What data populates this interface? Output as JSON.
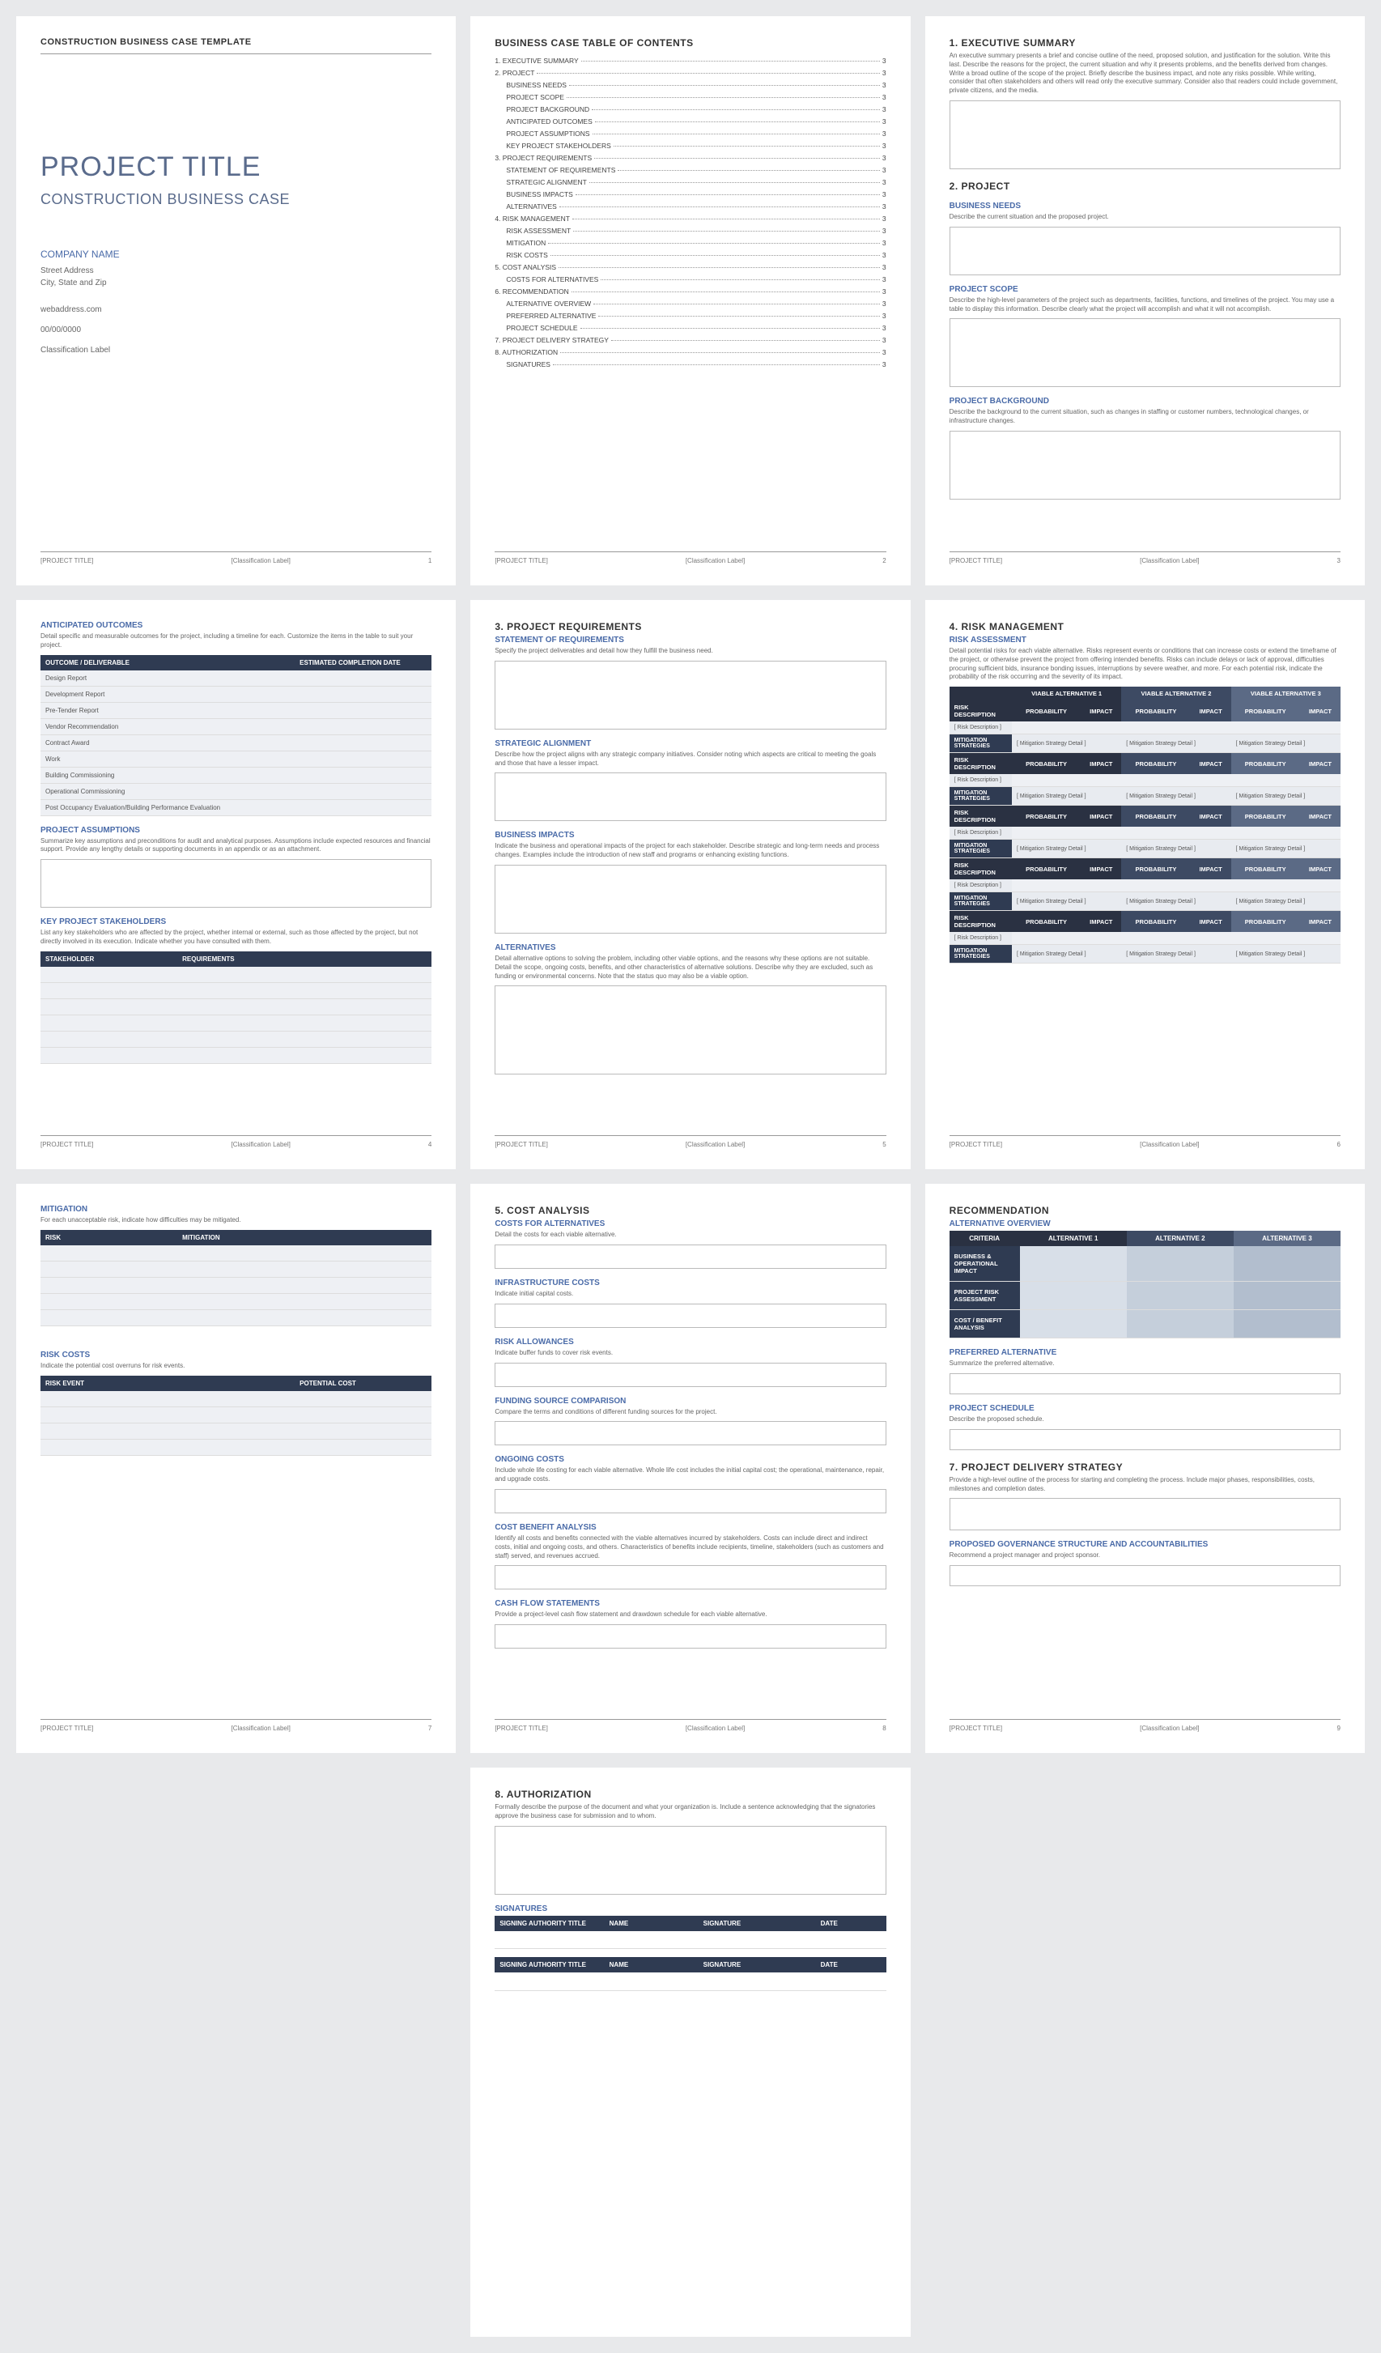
{
  "doc": {
    "header": "CONSTRUCTION BUSINESS CASE TEMPLATE",
    "projTitle": "PROJECT TITLE",
    "projSub": "CONSTRUCTION BUSINESS CASE",
    "company": "COMPANY NAME",
    "street": "Street Address",
    "city": "City, State and Zip",
    "web": "webaddress.com",
    "date": "00/00/0000",
    "classification": "Classification Label"
  },
  "footer": {
    "left": "[PROJECT TITLE]",
    "center": "[Classification Label]"
  },
  "pageNums": {
    "p1": "1",
    "p2": "2",
    "p3": "3",
    "p4": "4",
    "p5": "5",
    "p6": "6",
    "p7": "7",
    "p8": "8",
    "p9": "9"
  },
  "toc": {
    "title": "BUSINESS CASE TABLE OF CONTENTS",
    "items": [
      {
        "l": "1.  EXECUTIVE SUMMARY",
        "p": "3",
        "s": 0
      },
      {
        "l": "2.  PROJECT",
        "p": "3",
        "s": 0
      },
      {
        "l": "BUSINESS NEEDS",
        "p": "3",
        "s": 1
      },
      {
        "l": "PROJECT SCOPE",
        "p": "3",
        "s": 1
      },
      {
        "l": "PROJECT BACKGROUND",
        "p": "3",
        "s": 1
      },
      {
        "l": "ANTICIPATED OUTCOMES",
        "p": "3",
        "s": 1
      },
      {
        "l": "PROJECT ASSUMPTIONS",
        "p": "3",
        "s": 1
      },
      {
        "l": "KEY PROJECT STAKEHOLDERS",
        "p": "3",
        "s": 1
      },
      {
        "l": "3.  PROJECT REQUIREMENTS",
        "p": "3",
        "s": 0
      },
      {
        "l": "STATEMENT OF REQUIREMENTS",
        "p": "3",
        "s": 1
      },
      {
        "l": "STRATEGIC ALIGNMENT",
        "p": "3",
        "s": 1
      },
      {
        "l": "BUSINESS IMPACTS",
        "p": "3",
        "s": 1
      },
      {
        "l": "ALTERNATIVES",
        "p": "3",
        "s": 1
      },
      {
        "l": "4.  RISK MANAGEMENT",
        "p": "3",
        "s": 0
      },
      {
        "l": "RISK ASSESSMENT",
        "p": "3",
        "s": 1
      },
      {
        "l": "MITIGATION",
        "p": "3",
        "s": 1
      },
      {
        "l": "RISK COSTS",
        "p": "3",
        "s": 1
      },
      {
        "l": "5.  COST ANALYSIS",
        "p": "3",
        "s": 0
      },
      {
        "l": "COSTS FOR ALTERNATIVES",
        "p": "3",
        "s": 1
      },
      {
        "l": "6.  RECOMMENDATION",
        "p": "3",
        "s": 0
      },
      {
        "l": "ALTERNATIVE OVERVIEW",
        "p": "3",
        "s": 1
      },
      {
        "l": "PREFERRED ALTERNATIVE",
        "p": "3",
        "s": 1
      },
      {
        "l": "PROJECT SCHEDULE",
        "p": "3",
        "s": 1
      },
      {
        "l": "7.  PROJECT DELIVERY STRATEGY",
        "p": "3",
        "s": 0
      },
      {
        "l": "8.  AUTHORIZATION",
        "p": "3",
        "s": 0
      },
      {
        "l": "SIGNATURES",
        "p": "3",
        "s": 1
      }
    ]
  },
  "p3": {
    "h1": "1. EXECUTIVE SUMMARY",
    "d1": "An executive summary presents a brief and concise outline of the need, proposed solution, and justification for the solution. Write this last. Describe the reasons for the project, the current situation and why it presents problems, and the benefits derived from changes. Write a broad outline of the scope of the project. Briefly describe the business impact, and note any risks possible. While writing, consider that often stakeholders and others will read only the executive summary. Consider also that readers could include government, private citizens, and the media.",
    "h2": "2. PROJECT",
    "bn": "BUSINESS NEEDS",
    "bnd": "Describe the current situation and the proposed project.",
    "ps": "PROJECT SCOPE",
    "psd": "Describe the high-level parameters of the project such as departments, facilities, functions, and timelines of the project. You may use a table to display this information. Describe clearly what the project will accomplish and what it will not accomplish.",
    "pb": "PROJECT BACKGROUND",
    "pbd": "Describe the background to the current situation, such as changes in staffing or customer numbers, technological changes, or infrastructure changes."
  },
  "p4": {
    "ao": "ANTICIPATED OUTCOMES",
    "aod": "Detail specific and measurable outcomes for the project, including a timeline for each. Customize the items in the table to suit your project.",
    "th1": "OUTCOME / DELIVERABLE",
    "th2": "ESTIMATED COMPLETION DATE",
    "rows": [
      "Design Report",
      "Development Report",
      "Pre-Tender Report",
      "Vendor Recommendation",
      "Contract Award",
      "Work",
      "Building Commissioning",
      "Operational Commissioning",
      "Post Occupancy Evaluation/Building Performance Evaluation"
    ],
    "pa": "PROJECT ASSUMPTIONS",
    "pad": "Summarize key assumptions and preconditions for audit and analytical purposes. Assumptions include expected resources and financial support. Provide any lengthy details or supporting documents in an appendix or as an attachment.",
    "ks": "KEY PROJECT STAKEHOLDERS",
    "ksd": "List any key stakeholders who are affected by the project, whether internal or external, such as those affected by the project, but not directly involved in its execution. Indicate whether you have consulted with them.",
    "th3": "STAKEHOLDER",
    "th4": "REQUIREMENTS"
  },
  "p5": {
    "h": "3. PROJECT REQUIREMENTS",
    "sr": "STATEMENT OF REQUIREMENTS",
    "srd": "Specify the project deliverables and detail how they fulfill the business need.",
    "sa": "STRATEGIC ALIGNMENT",
    "sad": "Describe how the project aligns with any strategic company initiatives. Consider noting which aspects are critical to meeting the goals and those that have a lesser impact.",
    "bi": "BUSINESS IMPACTS",
    "bid": "Indicate the business and operational impacts of the project for each stakeholder. Describe strategic and long-term needs and process changes. Examples include the introduction of new staff and programs or enhancing existing functions.",
    "al": "ALTERNATIVES",
    "ald": "Detail alternative options to solving the problem, including other viable options, and the reasons why these options are not suitable. Detail the scope, ongoing costs, benefits, and other characteristics of alternative solutions. Describe why they are excluded, such as funding or environmental concerns. Note that the status quo may also be a viable option."
  },
  "p6": {
    "h": "4. RISK MANAGEMENT",
    "ra": "RISK ASSESSMENT",
    "rad": "Detail potential risks for each viable alternative. Risks represent events or conditions that can increase costs or extend the timeframe of the project, or otherwise prevent the project from offering intended benefits. Risks can include delays or lack of approval, difficulties procuring sufficient bids, insurance bonding issues, interruptions by severe weather, and more. For each potential risk, indicate the probability of the risk occurring and the severity of its impact.",
    "va1": "VIABLE ALTERNATIVE 1",
    "va2": "VIABLE ALTERNATIVE 2",
    "va3": "VIABLE ALTERNATIVE 3",
    "rd": "RISK DESCRIPTION",
    "pr": "PROBABILITY",
    "im": "IMPACT",
    "ms": "MITIGATION STRATEGIES",
    "rdp": "[ Risk Description ]",
    "msd": "[ Mitigation Strategy Detail ]"
  },
  "p7": {
    "mi": "MITIGATION",
    "mid": "For each unacceptable risk, indicate how difficulties may be mitigated.",
    "th1": "RISK",
    "th2": "MITIGATION",
    "rc": "RISK COSTS",
    "rcd": "Indicate the potential cost overruns for risk events.",
    "th3": "RISK EVENT",
    "th4": "POTENTIAL COST"
  },
  "p8": {
    "h": "5. COST ANALYSIS",
    "ca": "COSTS FOR ALTERNATIVES",
    "cad": "Detail the costs for each viable alternative.",
    "ic": "INFRASTRUCTURE COSTS",
    "icd": "Indicate initial capital costs.",
    "ra": "RISK ALLOWANCES",
    "rad2": "Indicate buffer funds to cover risk events.",
    "fs": "FUNDING SOURCE COMPARISON",
    "fsd": "Compare the terms and conditions of different funding sources for the project.",
    "oc": "ONGOING COSTS",
    "ocd": "Include whole life costing for each viable alternative. Whole life cost includes the initial capital cost; the operational, maintenance, repair, and upgrade costs.",
    "cb": "COST BENEFIT ANALYSIS",
    "cbd": "Identify all costs and benefits connected with the viable alternatives incurred by stakeholders. Costs can include direct and indirect costs, initial and ongoing costs, and others. Characteristics of benefits include recipients, timeline, stakeholders (such as customers and staff) served, and revenues accrued.",
    "cf": "CASH FLOW STATEMENTS",
    "cfd": "Provide a project-level cash flow statement and drawdown schedule for each viable alternative."
  },
  "p9": {
    "h": "RECOMMENDATION",
    "ao": "ALTERNATIVE OVERVIEW",
    "cr": "CRITERIA",
    "a1": "ALTERNATIVE 1",
    "a2": "ALTERNATIVE 2",
    "a3": "ALTERNATIVE 3",
    "c1": "BUSINESS & OPERATIONAL IMPACT",
    "c2": "PROJECT RISK ASSESSMENT",
    "c3": "COST / BENEFIT ANALYSIS",
    "pa": "PREFERRED ALTERNATIVE",
    "pad2": "Summarize the preferred alternative.",
    "ps": "PROJECT SCHEDULE",
    "psd2": "Describe the proposed schedule.",
    "h7": "7. PROJECT DELIVERY STRATEGY",
    "h7d": "Provide a high-level outline of the process for starting and completing the process. Include major phases, responsibilities, costs, milestones and completion dates.",
    "pg": "PROPOSED GOVERNANCE STRUCTURE AND ACCOUNTABILITIES",
    "pgd": "Recommend a project manager and project sponsor."
  },
  "p10": {
    "h": "8. AUTHORIZATION",
    "hd": "Formally describe the purpose of the document and what your organization is. Include a sentence acknowledging that the signatories approve the business case for submission and to whom.",
    "sg": "SIGNATURES",
    "th1": "SIGNING AUTHORITY TITLE",
    "th2": "NAME",
    "th3": "SIGNATURE",
    "th4": "DATE"
  }
}
